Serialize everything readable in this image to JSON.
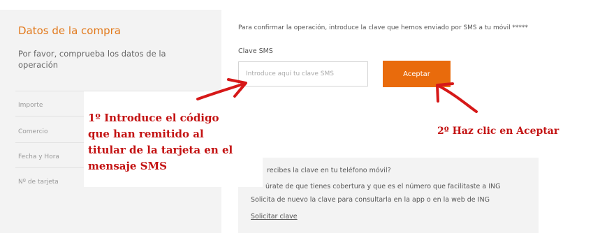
{
  "purchase": {
    "title": "Datos de la compra",
    "description": "Por favor, comprueba los datos de la operación",
    "rows": [
      {
        "label": "Importe"
      },
      {
        "label": "Comercio"
      },
      {
        "label": "Fecha y Hora"
      },
      {
        "label": "Nº de tarjeta"
      }
    ],
    "importe_value_partial": "("
  },
  "sms": {
    "instructions": "Para confirmar la operación, introduce la clave que hemos enviado por SMS a tu móvil *****",
    "field_label": "Clave SMS",
    "input_placeholder": "Introduce aquí tu clave SMS",
    "input_value": "",
    "accept_label": "Aceptar"
  },
  "help": {
    "question_partial": "recibes la clave en tu teléfono móvil?",
    "tip_partial": "úrate de que tienes cobertura y que es el número que facilitaste a ING",
    "retry_text": "Solicita de nuevo la clave para consultarla en la app o en la web de ING",
    "request_link": "Solicitar clave"
  },
  "annotations": {
    "step1_lines": [
      "1º Introduce el código",
      "que han remitido al",
      "titular de la tarjeta en el",
      "mensaje SMS"
    ],
    "step2": "2º Haz clic en Aceptar"
  },
  "colors": {
    "accent": "#e2791b",
    "button": "#e96b0c",
    "annotation_red": "#c31212",
    "panel_bg": "#f3f3f3"
  }
}
